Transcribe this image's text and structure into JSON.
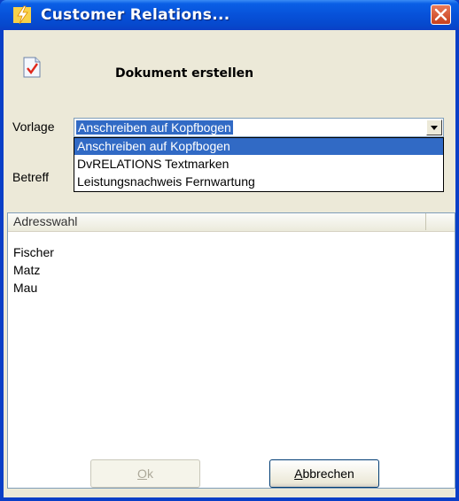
{
  "window": {
    "title": "Customer Relations..."
  },
  "dialog": {
    "heading": "Dokument erstellen"
  },
  "form": {
    "vorlage_label": "Vorlage",
    "betreff_label": "Betreff",
    "vorlage_selected": "Anschreiben auf Kopfbogen",
    "dropdown_options": [
      "Anschreiben auf Kopfbogen",
      "DvRELATIONS Textmarken",
      "Leistungsnachweis Fernwartung"
    ],
    "dropdown_highlighted_index": 0
  },
  "address_list": {
    "column_header": "Adresswahl",
    "rows": [
      "Fischer",
      "Matz",
      "Mau"
    ]
  },
  "buttons": {
    "ok": {
      "mnemonic": "O",
      "rest": "k",
      "enabled": false
    },
    "cancel": {
      "mnemonic": "A",
      "rest": "bbrechen",
      "enabled": true
    }
  },
  "colors": {
    "titlebar": "#0751d9",
    "selection": "#316ac5",
    "dialog_bg": "#ece9d8",
    "close_button": "#c8401c"
  },
  "icons": {
    "app": "lightning-icon",
    "close": "close-icon",
    "document": "document-check-icon",
    "combo_arrow": "chevron-down-icon"
  }
}
